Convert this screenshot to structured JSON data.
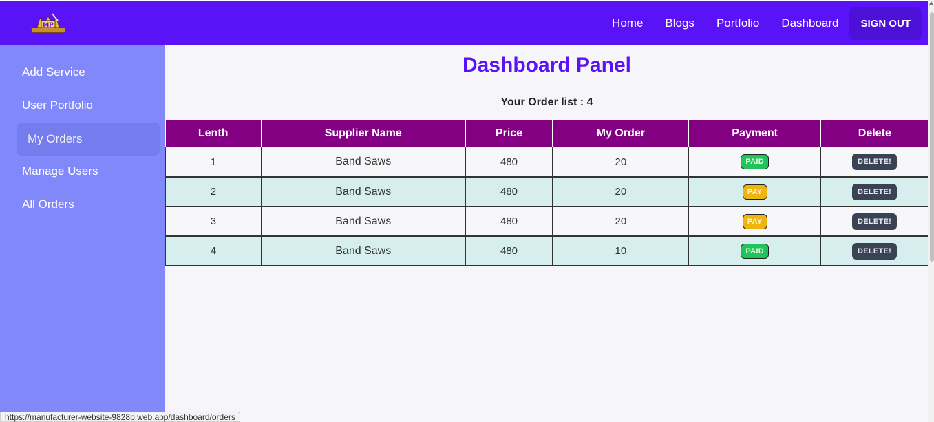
{
  "nav": {
    "links": [
      "Home",
      "Blogs",
      "Portfolio",
      "Dashboard"
    ],
    "signout_label": "SIGN OUT"
  },
  "sidebar": {
    "items": [
      "Add Service",
      "User Portfolio",
      "My Orders",
      "Manage Users",
      "All Orders"
    ],
    "active": "My Orders"
  },
  "main": {
    "title": "Dashboard Panel",
    "order_count_label": "Your Order list : 4"
  },
  "table": {
    "headers": [
      "Lenth",
      "Supplier Name",
      "Price",
      "My Order",
      "Payment",
      "Delete"
    ],
    "rows": [
      {
        "lenth": "1",
        "supplier": "Band Saws",
        "price": "480",
        "order": "20",
        "payment": "PAID",
        "delete": "DELETE!"
      },
      {
        "lenth": "2",
        "supplier": "Band Saws",
        "price": "480",
        "order": "20",
        "payment": "PAY",
        "delete": "DELETE!"
      },
      {
        "lenth": "3",
        "supplier": "Band Saws",
        "price": "480",
        "order": "20",
        "payment": "PAY",
        "delete": "DELETE!"
      },
      {
        "lenth": "4",
        "supplier": "Band Saws",
        "price": "480",
        "order": "10",
        "payment": "PAID",
        "delete": "DELETE!"
      }
    ]
  },
  "status_bar": {
    "url": "https://manufacturer-website-9828b.web.app/dashboard/orders"
  },
  "colors": {
    "navbar": "#5a12f7",
    "sidebar": "#8188f9",
    "table_header": "#830083",
    "paid": "#22c35a",
    "pay": "#f0b40f",
    "delete": "#3a4354"
  },
  "icons": {
    "logo": "mp-logo-icon"
  }
}
